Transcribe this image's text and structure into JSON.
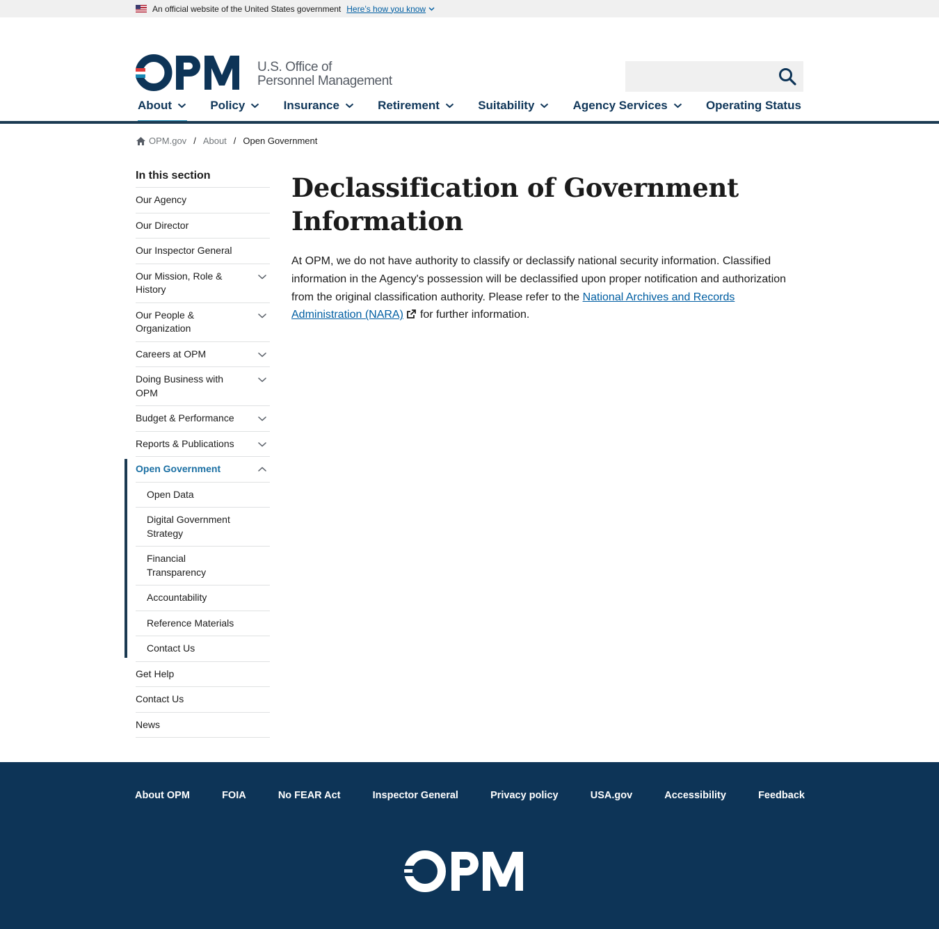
{
  "banner": {
    "text": "An official website of the United States government",
    "link": "Here’s how you know"
  },
  "header": {
    "logo_text_line1": "U.S. Office of",
    "logo_text_line2": "Personnel Management",
    "search_placeholder": ""
  },
  "nav": {
    "items": [
      {
        "label": "About"
      },
      {
        "label": "Policy"
      },
      {
        "label": "Insurance"
      },
      {
        "label": "Retirement"
      },
      {
        "label": "Suitability"
      },
      {
        "label": "Agency Services"
      },
      {
        "label": "Operating Status"
      }
    ]
  },
  "breadcrumb": {
    "home": "OPM.gov",
    "about": "About",
    "current": "Open Government"
  },
  "sidebar": {
    "title": "In this section",
    "items": [
      {
        "label": "Our Agency"
      },
      {
        "label": "Our Director"
      },
      {
        "label": "Our Inspector General"
      },
      {
        "label": "Our Mission, Role & History"
      },
      {
        "label": "Our People & Organization"
      },
      {
        "label": "Careers at OPM"
      },
      {
        "label": "Doing Business with OPM"
      },
      {
        "label": "Budget & Performance"
      },
      {
        "label": "Reports & Publications"
      },
      {
        "label": "Open Government"
      },
      {
        "label": "Get Help"
      },
      {
        "label": "Contact Us"
      },
      {
        "label": "News"
      }
    ],
    "sub_items": [
      {
        "label": "Open Data"
      },
      {
        "label": "Digital Government Strategy"
      },
      {
        "label": "Financial Transparency"
      },
      {
        "label": "Accountability"
      },
      {
        "label": "Reference Materials"
      },
      {
        "label": "Contact Us"
      }
    ]
  },
  "main": {
    "title": "Declassification of Government Information",
    "body_start": "At OPM, we do not have authority to classify or declassify national security information. Classified information in the Agency's possession will be declassified upon proper notification and authorization from the original classification authority. Please refer to the ",
    "link_text": "National Archives and Records Administration (NARA)",
    "body_end": "for further information."
  },
  "footer": {
    "links": [
      {
        "label": "About OPM"
      },
      {
        "label": "FOIA"
      },
      {
        "label": "No FEAR Act"
      },
      {
        "label": "Inspector General"
      },
      {
        "label": "Privacy policy"
      },
      {
        "label": "USA.gov"
      },
      {
        "label": "Accessibility"
      },
      {
        "label": "Feedback"
      }
    ]
  },
  "colors": {
    "navy": "#0d3457",
    "nav_text": "#0f3659",
    "accent_teal": "#1a8ab5",
    "link_blue": "#005ea2",
    "logo_red": "#e23b3b"
  },
  "icons": {
    "search": "search-icon",
    "home": "home-icon",
    "chevron": "chevron-down-icon",
    "external": "external-link-icon"
  }
}
